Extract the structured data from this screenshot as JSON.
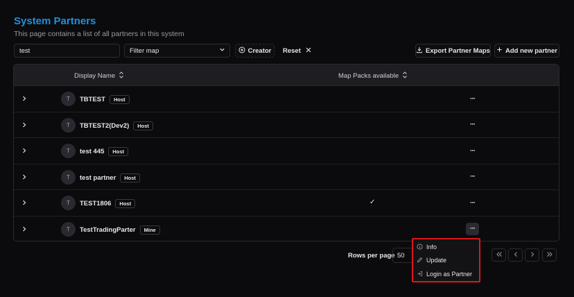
{
  "page": {
    "title": "System Partners",
    "subtitle": "This page contains a list of all partners in this system"
  },
  "toolbar": {
    "search_value": "test",
    "filter_placeholder": "Filter map",
    "creator_label": "Creator",
    "reset_label": "Reset",
    "export_label": "Export Partner Maps",
    "add_label": "Add new partner"
  },
  "table": {
    "columns": [
      "Display Name",
      "Map Packs available"
    ],
    "rows": [
      {
        "initial": "T",
        "name": "TBTEST",
        "badge": "Host",
        "map_packs": false
      },
      {
        "initial": "T",
        "name": "TBTEST2(Dev2)",
        "badge": "Host",
        "map_packs": false
      },
      {
        "initial": "T",
        "name": "test 445",
        "badge": "Host",
        "map_packs": false
      },
      {
        "initial": "T",
        "name": "test partner",
        "badge": "Host",
        "map_packs": false
      },
      {
        "initial": "T",
        "name": "TEST1806",
        "badge": "Host",
        "map_packs": true
      },
      {
        "initial": "T",
        "name": "TestTradingParter",
        "badge": "Mine",
        "map_packs": false
      }
    ],
    "actions_glyph": "···",
    "check_glyph": "✓"
  },
  "pagination": {
    "rows_per_page_label": "Rows per page",
    "rows_per_page_value": "50"
  },
  "context_menu": {
    "items": [
      "Info",
      "Update",
      "Login as Partner"
    ]
  },
  "colors": {
    "accent": "#1f8fe0",
    "highlight_border": "#e0161e",
    "background": "#0b0b0d"
  },
  "icons": {
    "sort": "sort-icon",
    "expand": "chevron-right-icon",
    "actions": "more-horizontal-icon",
    "info": "info-icon",
    "update": "pencil-icon",
    "login": "login-icon"
  }
}
